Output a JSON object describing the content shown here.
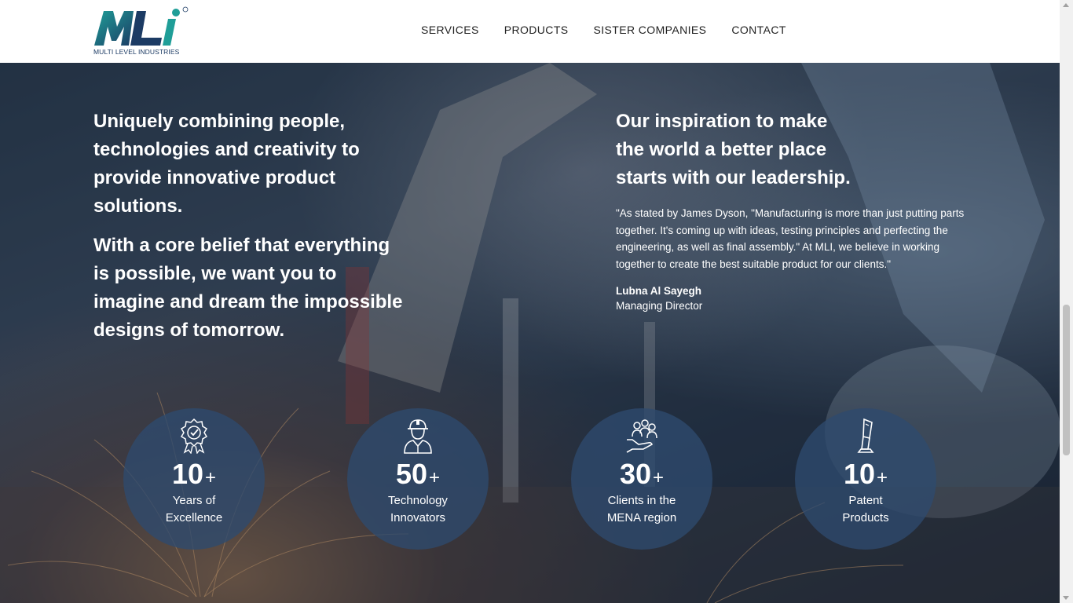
{
  "header": {
    "logo_sub": "MULTI LEVEL INDUSTRIES",
    "nav": [
      "SERVICES",
      "PRODUCTS",
      "SISTER COMPANIES",
      "CONTACT"
    ]
  },
  "left": {
    "p1": "Uniquely combining people, technologies and creativity to provide innovative product solutions.",
    "p2": "With a core belief that everything is possible, we want you to imagine and dream the impossible designs of tomorrow."
  },
  "right": {
    "heading": "Our inspiration to make the world a better place starts with our leadership.",
    "quote": "\"As stated by James Dyson, \"Manufacturing is more than just putting parts together. It's coming up with ideas, testing principles and perfecting the engineering, as well as final assembly.\" At MLI, we believe in working together to create the best suitable product for our clients.\"",
    "author": "Lubna Al Sayegh",
    "role": "Managing Director"
  },
  "stats": [
    {
      "number": "10",
      "plus": "+",
      "line1": "Years of",
      "line2": "Excellence",
      "icon": "award-badge-icon"
    },
    {
      "number": "50",
      "plus": "+",
      "line1": "Technology",
      "line2": "Innovators",
      "icon": "engineer-icon"
    },
    {
      "number": "30",
      "plus": "+",
      "line1": "Clients in the",
      "line2": "MENA region",
      "icon": "clients-hand-icon"
    },
    {
      "number": "10",
      "plus": "+",
      "line1": "Patent",
      "line2": "Products",
      "icon": "kiosk-icon"
    }
  ],
  "colors": {
    "brand_teal": "#1a8f8f",
    "brand_navy": "#1c3b64",
    "stat_circle": "#2e4a6e"
  }
}
